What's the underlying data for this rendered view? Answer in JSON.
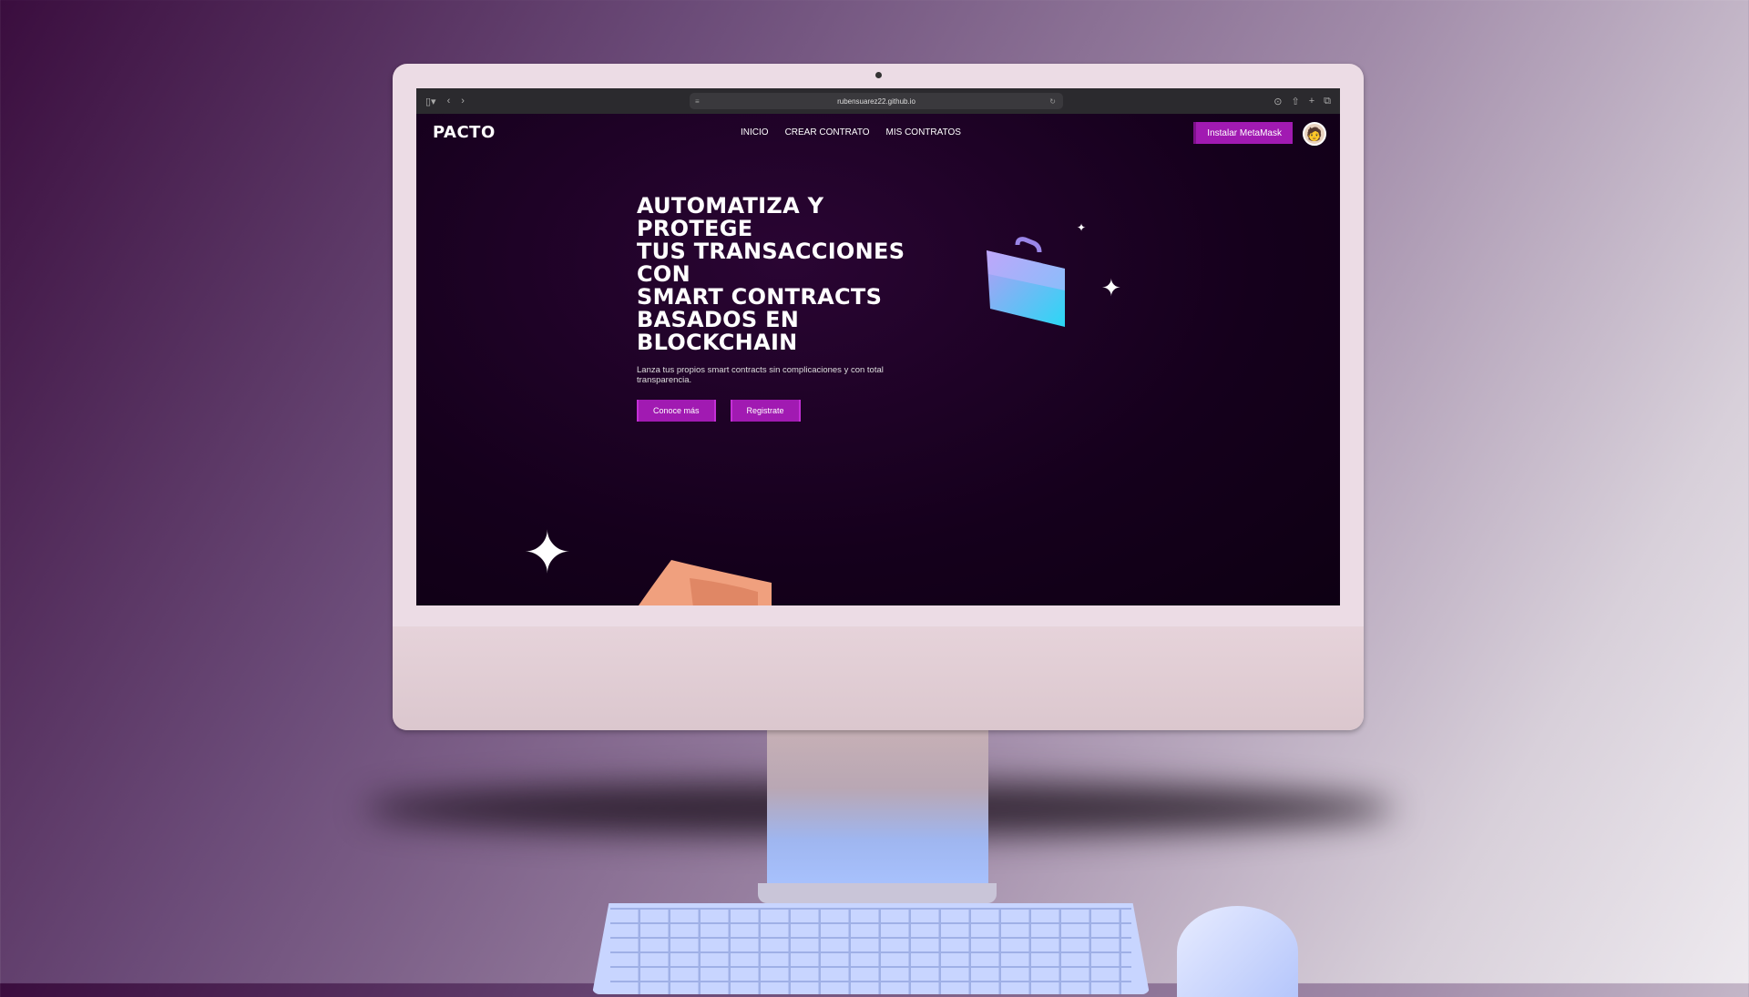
{
  "browser": {
    "url": "rubensuarez22.github.io"
  },
  "site": {
    "logo": "PACTO",
    "nav": [
      "INICIO",
      "CREAR CONTRATO",
      "MIS CONTRATOS"
    ],
    "install_button": "Instalar MetaMask",
    "hero": {
      "title": "AUTOMATIZA Y PROTEGE\nTUS TRANSACCIONES\nCON\nSMART CONTRACTS\nBASADOS EN\nBLOCKCHAIN",
      "subtitle": "Lanza tus propios smart contracts sin complicaciones y con total transparencia.",
      "buttons": [
        "Conoce más",
        "Registrate"
      ]
    }
  },
  "colors": {
    "accent": "#a11ab2",
    "background": "#15001c"
  }
}
